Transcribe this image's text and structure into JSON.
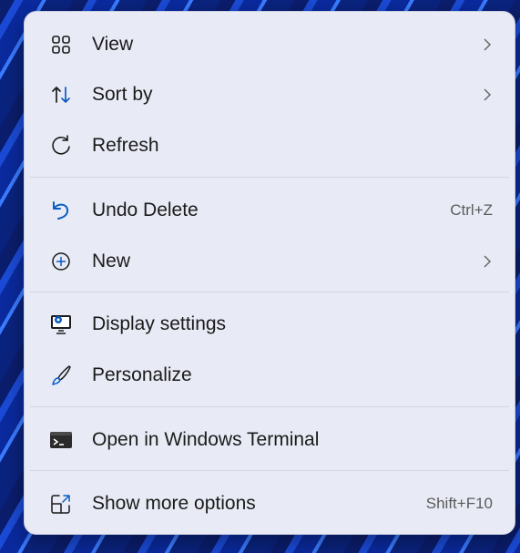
{
  "menu": {
    "items": [
      {
        "label": "View",
        "icon": "grid-icon",
        "submenu": true
      },
      {
        "label": "Sort by",
        "icon": "sort-arrows-icon",
        "submenu": true
      },
      {
        "label": "Refresh",
        "icon": "refresh-icon",
        "submenu": false
      },
      {
        "label": "Undo Delete",
        "icon": "undo-icon",
        "shortcut": "Ctrl+Z"
      },
      {
        "label": "New",
        "icon": "plus-circle-icon",
        "submenu": true
      },
      {
        "label": "Display settings",
        "icon": "display-settings-icon",
        "submenu": false
      },
      {
        "label": "Personalize",
        "icon": "paintbrush-icon",
        "submenu": false
      },
      {
        "label": "Open in Windows Terminal",
        "icon": "terminal-icon",
        "submenu": false
      },
      {
        "label": "Show more options",
        "icon": "show-more-icon",
        "shortcut": "Shift+F10"
      }
    ]
  },
  "colors": {
    "menu_background": "#e8ebf5",
    "accent_blue": "#0a5bc4",
    "text": "#1b1b1b"
  }
}
